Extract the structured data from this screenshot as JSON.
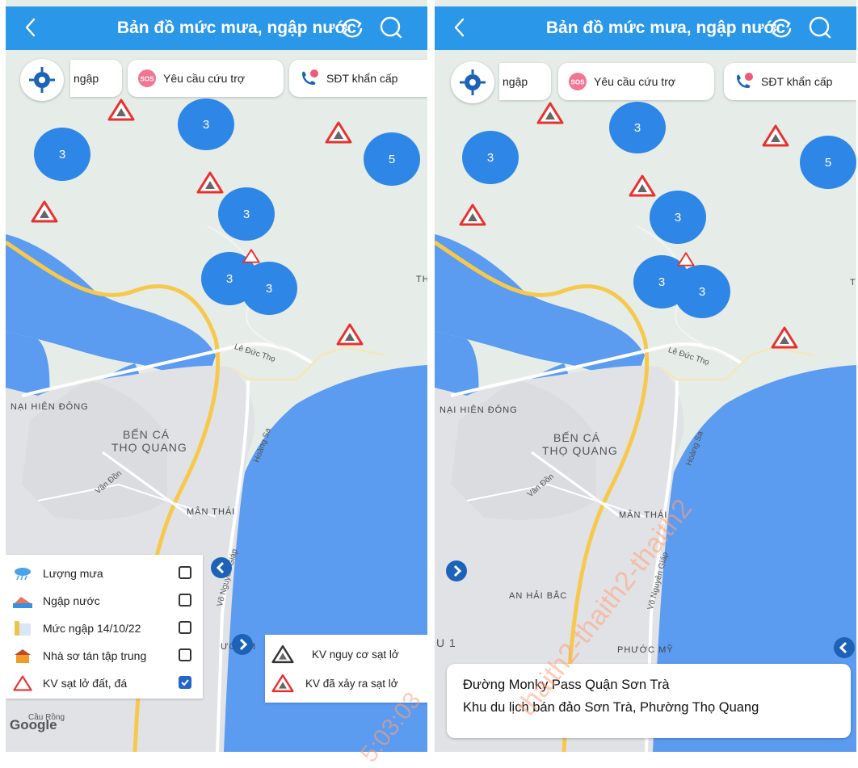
{
  "app": {
    "title": "Bản đồ mức mưa, ngập nước",
    "icons": {
      "back": "chevron-left-icon",
      "refresh": "refresh-icon",
      "search": "search-icon",
      "locate": "locate-icon"
    }
  },
  "chips": {
    "flood_partial": "ngập",
    "rescue": "Yêu cầu cứu trợ",
    "emergency": "SĐT khẩn cấp"
  },
  "colors": {
    "header": "#2b97e8",
    "cluster": "#2e86e6",
    "land": "#e5eee9",
    "water": "#5598f0",
    "road": "#f6c94e",
    "hazard": "#e8312f"
  },
  "screen1": {
    "clusters": [
      "3",
      "3",
      "5",
      "3",
      "3",
      "3"
    ],
    "map_labels": {
      "le_duc_tho": "Lê Đức Thọ",
      "nai_hien_dong": "NẠI HIÊN ĐÔNG",
      "ben_ca_1": "BẾN CÁ",
      "ben_ca_2": "THỌ QUANG",
      "hoang_sa": "Hoàng Sa",
      "van_don": "Vân Đồn",
      "man_thai": "MÂN THÁI",
      "vo_nguyen_giap": "Võ Nguyên Giáp",
      "phuoc_my": "ƯỚC M",
      "th": "TH",
      "cau_rong": "Cầu Rồng",
      "google": "Google"
    },
    "legend": [
      {
        "label": "Lượng mưa",
        "icon": "rain-cloud-icon",
        "checked": false
      },
      {
        "label": "Ngập nước",
        "icon": "flood-icon",
        "checked": false
      },
      {
        "label": "Mức ngập 14/10/22",
        "icon": "flood-level-icon",
        "checked": false
      },
      {
        "label": "Nhà sơ tán tập trung",
        "icon": "shelter-icon",
        "checked": false
      },
      {
        "label": "KV sạt lở đất, đá",
        "icon": "landslide-icon",
        "checked": true
      }
    ],
    "landslide_legend": {
      "risk": "KV nguy cơ sạt lở",
      "occurred": "KV đã xảy ra sạt lở"
    }
  },
  "screen2": {
    "clusters": [
      "3",
      "3",
      "5",
      "3",
      "3",
      "3"
    ],
    "map_labels": {
      "le_duc_tho": "Lê Đức Thọ",
      "nai_hien_dong": "NẠI HIÊN ĐÔNG",
      "ben_ca_1": "BẾN CÁ",
      "ben_ca_2": "THỌ QUANG",
      "hoang_sa": "Hoàng Sa",
      "van_don": "Vân Đồn",
      "man_thai": "MÂN THÁI",
      "vo_nguyen_giap": "Võ Nguyên Giáp",
      "an_hai_bac": "AN HẢI BẮC",
      "phuoc_my": "PHƯỚC MỸ",
      "u1": "U 1",
      "th": "T"
    },
    "info": {
      "line1": "Đường Monky Pass Quận Sơn Trà",
      "line2": "Khu du lịch bán đảo Sơn Trà, Phường Thọ Quang"
    }
  },
  "watermark": {
    "text1": "thaith2-thaith2-thaith2",
    "text2": "5:03:03"
  }
}
